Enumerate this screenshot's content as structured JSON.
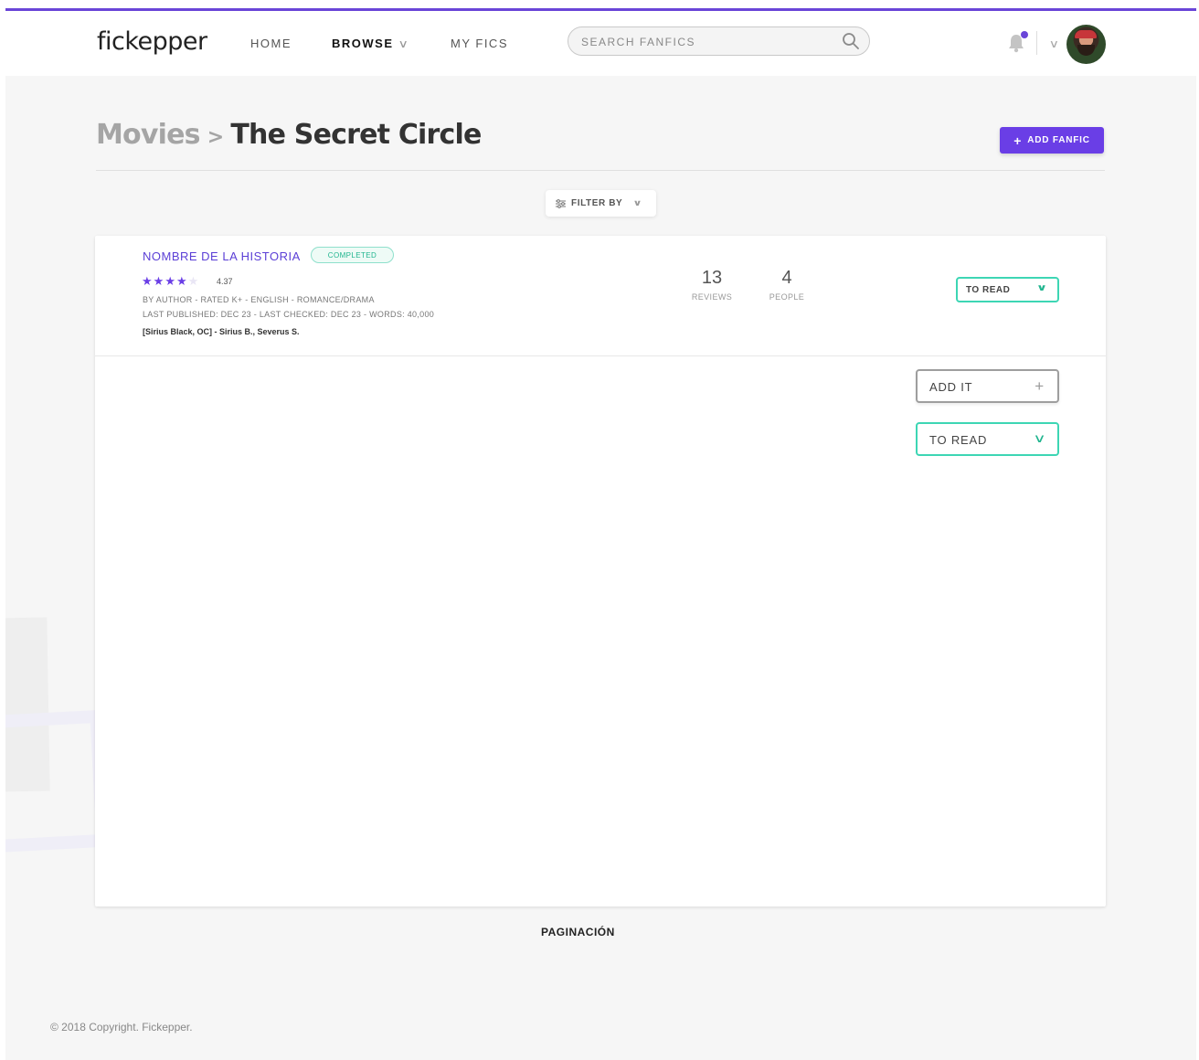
{
  "header": {
    "logo": "fickepper",
    "nav": {
      "home": "HOME",
      "browse": "BROWSE",
      "my_fics": "MY FICS"
    },
    "search_placeholder": "SEARCH FANFICS",
    "accent_color": "#6a45d8"
  },
  "title": {
    "category": "Movies",
    "separator": ">",
    "current": "The Secret Circle"
  },
  "add_fanfic_label": "ADD FANFIC",
  "filter_label": "FILTER BY",
  "story": {
    "title": "NOMBRE DE LA HISTORIA",
    "status": "COMPLETED",
    "rating_value": "4.37",
    "stars_filled": 4,
    "stars_total": 5,
    "meta_line1": "BY AUTHOR - RATED K+ - ENGLISH - ROMANCE/DRAMA",
    "meta_line2": "LAST PUBLISHED: DEC 23 - LAST CHECKED: DEC 23 - WORDS: 40,000",
    "characters": "[Sirius Black, OC] - Sirius B., Severus S.",
    "reviews_count": "13",
    "reviews_label": "REVIEWS",
    "people_count": "4",
    "people_label": "PEOPLE",
    "list_select": "TO READ"
  },
  "controls": {
    "add_it": "ADD IT",
    "to_read": "TO READ"
  },
  "pagination": "PAGINACIÓN",
  "footer": "© 2018 Copyright. Fickepper.",
  "colors": {
    "primary": "#6a3ee6",
    "teal": "#3dd6b4",
    "background": "#f6f6f6"
  }
}
